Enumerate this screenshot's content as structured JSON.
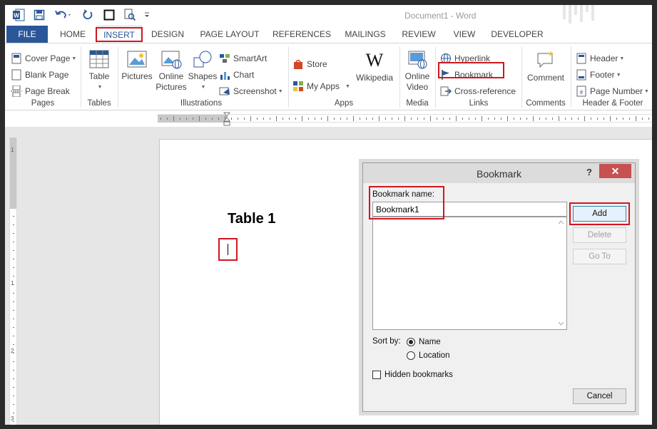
{
  "window": {
    "title": "Document1 - Word"
  },
  "tabs": [
    "FILE",
    "HOME",
    "INSERT",
    "DESIGN",
    "PAGE LAYOUT",
    "REFERENCES",
    "MAILINGS",
    "REVIEW",
    "VIEW",
    "DEVELOPER"
  ],
  "active_tab": "INSERT",
  "ribbon": {
    "pages": {
      "label": "Pages",
      "cover_page": "Cover Page",
      "blank_page": "Blank Page",
      "page_break": "Page Break"
    },
    "tables": {
      "label": "Tables",
      "table": "Table"
    },
    "illustrations": {
      "label": "Illustrations",
      "pictures": "Pictures",
      "online_pictures_line1": "Online",
      "online_pictures_line2": "Pictures",
      "shapes": "Shapes",
      "smartart": "SmartArt",
      "chart": "Chart",
      "screenshot": "Screenshot"
    },
    "apps": {
      "label": "Apps",
      "store": "Store",
      "my_apps": "My Apps",
      "wikipedia": "Wikipedia"
    },
    "media": {
      "label": "Media",
      "online_video_line1": "Online",
      "online_video_line2": "Video"
    },
    "links": {
      "label": "Links",
      "hyperlink": "Hyperlink",
      "bookmark": "Bookmark",
      "cross_reference": "Cross-reference"
    },
    "comments": {
      "label": "Comments",
      "comment": "Comment"
    },
    "header_footer": {
      "label": "Header & Footer",
      "header": "Header",
      "footer": "Footer",
      "page_number": "Page Number"
    }
  },
  "document": {
    "heading": "Table 1"
  },
  "vruler_numbers": [
    "1",
    "1",
    "2",
    "3"
  ],
  "dialog": {
    "title": "Bookmark",
    "help": "?",
    "close": "✕",
    "name_label": "Bookmark name:",
    "name_value": "Bookmark1",
    "add": "Add",
    "delete": "Delete",
    "goto": "Go To",
    "sort_by_label": "Sort by:",
    "sort_name": "Name",
    "sort_location": "Location",
    "sort_selected": "Name",
    "hidden_bookmarks": "Hidden bookmarks",
    "hidden_checked": false,
    "cancel": "Cancel"
  },
  "colors": {
    "accent": "#2b579a",
    "highlight": "#d0171e",
    "close": "#c75050"
  }
}
